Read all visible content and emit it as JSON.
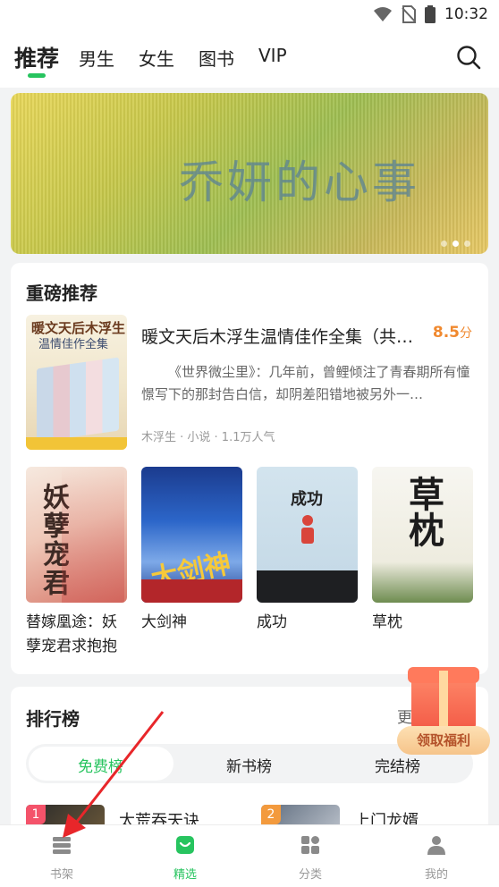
{
  "status_bar": {
    "time": "10:32"
  },
  "top_tabs": [
    "推荐",
    "男生",
    "女生",
    "图书",
    "VIP"
  ],
  "banner": {
    "title": "乔妍的心事",
    "dots": 3,
    "active_dot": 1
  },
  "featured": {
    "section_title": "重磅推荐",
    "book": {
      "title": "暖文天后木浮生温情佳作全集（共…",
      "score": "8.5",
      "score_unit": "分",
      "description": "《世界微尘里》：几年前，曾鲤倾注了青春期所有憧憬写下的那封告白信，却阴差阳错地被另外一…",
      "meta": "木浮生 · 小说 · 1.1万人气",
      "cover_line1": "暖文天后木浮生",
      "cover_line2": "温情佳作全集"
    },
    "grid": [
      {
        "title": "替嫁凰途：妖孽宠君求抱抱",
        "cover_text": "妖孽宠君"
      },
      {
        "title": "大剑神",
        "cover_text": "大剑神"
      },
      {
        "title": "成功",
        "cover_text": "成功"
      },
      {
        "title": "草枕",
        "cover_text": "草枕"
      }
    ]
  },
  "ranking": {
    "section_title": "排行榜",
    "more_label": "更",
    "tabs": [
      "免费榜",
      "新书榜",
      "完结榜"
    ],
    "active_tab": 0,
    "items": [
      {
        "rank": "1",
        "title": "太荒吞天诀"
      },
      {
        "rank": "2",
        "title": "上门龙婿"
      }
    ]
  },
  "gift": {
    "label": "领取福利"
  },
  "bottom_nav": [
    {
      "label": "书架",
      "icon": "bookshelf-icon"
    },
    {
      "label": "精选",
      "icon": "featured-bag-icon"
    },
    {
      "label": "分类",
      "icon": "category-grid-icon"
    },
    {
      "label": "我的",
      "icon": "profile-icon"
    }
  ],
  "colors": {
    "accent": "#27c45f",
    "score": "#f0892f",
    "rank1": "#f4536a",
    "rank2": "#f39a3d",
    "annotation_arrow": "#e8262a"
  }
}
